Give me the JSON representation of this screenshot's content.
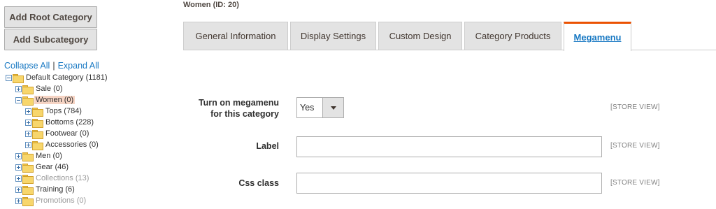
{
  "buttons": {
    "add_root": "Add Root Category",
    "add_sub": "Add Subcategory"
  },
  "tree_links": {
    "collapse_all": "Collapse All",
    "separator": "|",
    "expand_all": "Expand All"
  },
  "tree": {
    "default_category": "Default Category (1181)",
    "sale": "Sale (0)",
    "women": "Women (0)",
    "tops": "Tops (784)",
    "bottoms": "Bottoms (228)",
    "footwear": "Footwear (0)",
    "accessories": "Accessories (0)",
    "men": "Men (0)",
    "gear": "Gear (46)",
    "collections": "Collections (13)",
    "training": "Training (6)",
    "promotions": "Promotions (0)"
  },
  "page": {
    "heading": "Women (ID: 20)"
  },
  "tabs": [
    {
      "label": "General Information"
    },
    {
      "label": "Display Settings"
    },
    {
      "label": "Custom Design"
    },
    {
      "label": "Category Products"
    },
    {
      "label": "Megamenu"
    }
  ],
  "active_tab": "Megamenu",
  "form": {
    "megamenu_label_line1": "Turn on megamenu",
    "megamenu_label_line2": "for this category",
    "megamenu_value": "Yes",
    "label_label": "Label",
    "label_value": "",
    "css_label": "Css class",
    "css_value": "",
    "scope": "[STORE VIEW]"
  },
  "colors": {
    "accent": "#eb5202",
    "link": "#1979c3",
    "selected_node": "#f6d4c4"
  },
  "icons": [
    "plus-minus-icon",
    "folder-icon",
    "chevron-down-icon"
  ]
}
